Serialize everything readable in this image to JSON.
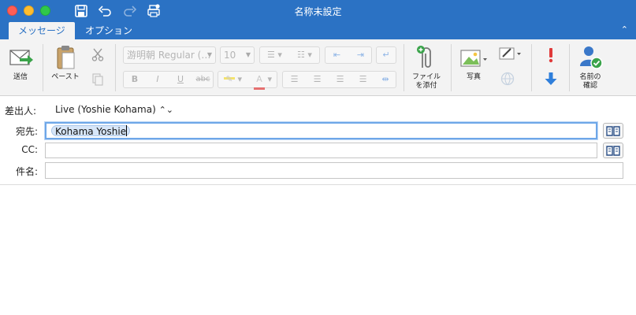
{
  "window": {
    "title": "名称未設定"
  },
  "tabs": {
    "message": "メッセージ",
    "options": "オプション"
  },
  "ribbon": {
    "send_label": "送信",
    "paste_label": "ペースト",
    "font_name": "游明朝 Regular (…",
    "font_size": "10",
    "format_bold": "B",
    "format_italic": "I",
    "format_underline": "U",
    "format_strike": "abc",
    "attach_line1": "ファイル",
    "attach_line2": "を添付",
    "picture_label": "写真",
    "check_names_line1": "名前の",
    "check_names_line2": "確認"
  },
  "header": {
    "from_label": "差出人:",
    "from_value": "Live (Yoshie Kohama)",
    "to_label": "宛先:",
    "to_recipient": "Kohama Yoshie",
    "cc_label": "CC:",
    "subject_label": "件名:"
  },
  "colors": {
    "accent": "#2b72c4",
    "send_arrow": "#3aa34a",
    "high_importance": "#e03a3a",
    "low_importance": "#2f7fdb"
  }
}
